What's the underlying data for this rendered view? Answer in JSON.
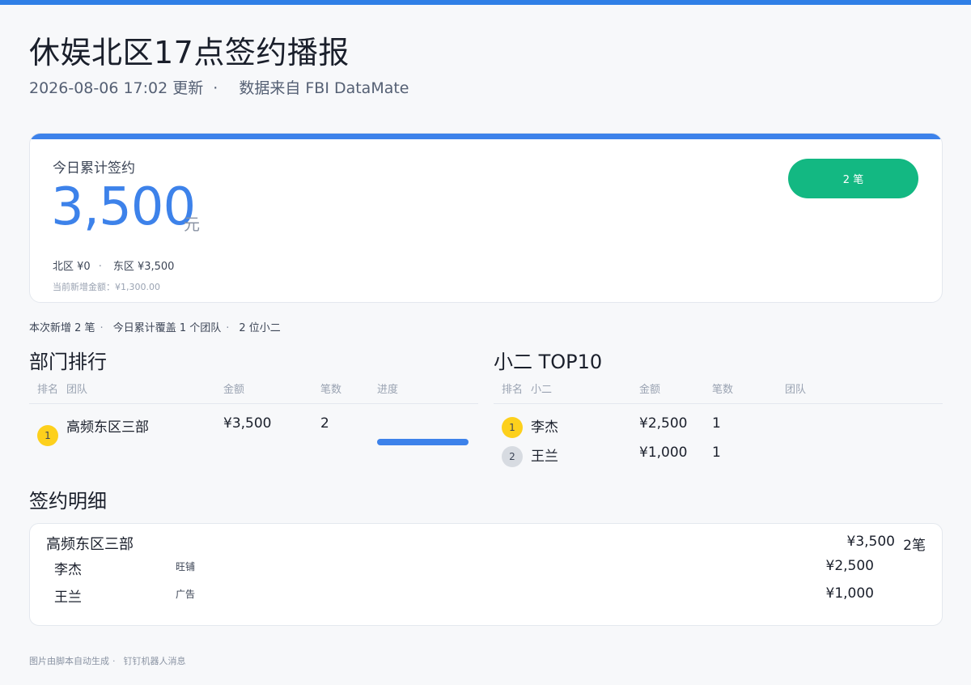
{
  "header": {
    "title": "休娱北区17点签约播报",
    "updated": "2026-08-06  17:02 更新",
    "separator": "·",
    "source": "数据来自 FBI DataMate"
  },
  "summary": {
    "label": "今日累计签约",
    "amount": "3,500",
    "unit": "元",
    "region_north": "北区 ¥0",
    "region_separator": "·",
    "region_east": "东区 ¥3,500",
    "new_amount": "当前新增金额：¥1,300.00",
    "count_pill": "2 笔"
  },
  "meta": {
    "new_count": "本次新增 2 笔",
    "teams": "今日累计覆盖 1 个团队",
    "people": "2 位小二",
    "separator": "·"
  },
  "dept_ranking": {
    "title": "部门排行",
    "headers": [
      "排名",
      "团队",
      "金额",
      "笔数",
      "进度"
    ],
    "rows": [
      {
        "rank": "1",
        "team": "高频东区三部",
        "amount": "¥3,500",
        "count": "2",
        "progress": 1.0
      }
    ]
  },
  "top10": {
    "title": "小二 TOP10",
    "headers": [
      "排名",
      "小二",
      "金额",
      "笔数",
      "团队"
    ],
    "rows": [
      {
        "rank": "1",
        "name": "李杰",
        "amount": "¥2,500",
        "count": "1",
        "team": ""
      },
      {
        "rank": "2",
        "name": "王兰",
        "amount": "¥1,000",
        "count": "1",
        "team": ""
      }
    ]
  },
  "details": {
    "title": "签约明细",
    "team": "高频东区三部",
    "team_total": "¥3,500",
    "team_count": "2笔",
    "items": [
      {
        "name": "李杰",
        "type": "旺铺",
        "amount": "¥2,500"
      },
      {
        "name": "王兰",
        "type": "广告",
        "amount": "¥1,000"
      }
    ]
  },
  "footer": {
    "generated": "图片由脚本自动生成",
    "separator": "·",
    "channel": "钉钉机器人消息"
  },
  "colors": {
    "accent": "#3d82ea",
    "pill": "#13b882",
    "gold": "#fdd01c",
    "silver": "#d7dbe1"
  }
}
